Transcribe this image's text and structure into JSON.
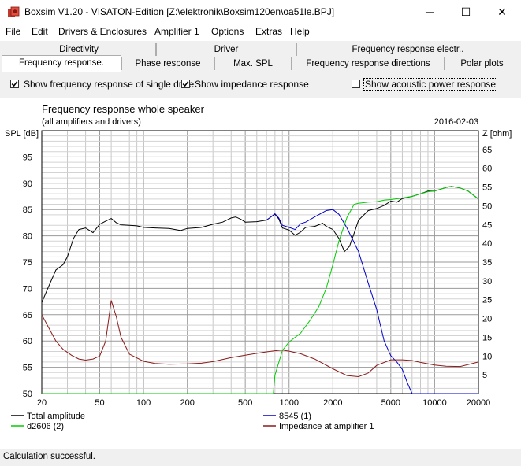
{
  "window": {
    "title": "Boxsim V1.20 - VISATON-Edition [Z:\\elektronik\\Boxsim120en\\oa51le.BPJ]",
    "minimize": "─",
    "maximize": "☐",
    "close": "✕"
  },
  "menu": [
    "File",
    "Edit",
    "Drivers & Enclosures",
    "Amplifier 1",
    "Options",
    "Extras",
    "Help"
  ],
  "tabs": {
    "row1": [
      "Directivity",
      "Driver",
      "Frequency response electr.."
    ],
    "row2": [
      "Frequency response.",
      "Phase response",
      "Max. SPL",
      "Frequency response directions",
      "Polar plots"
    ],
    "active": "Frequency response."
  },
  "options": {
    "single_drive": {
      "label": "Show frequency response of single drive",
      "checked": true
    },
    "impedance": {
      "label": "Show impedance response",
      "checked": true
    },
    "acoustic_power": {
      "label": "Show acoustic power response",
      "checked": false
    }
  },
  "status": "Calculation successful.",
  "chart_data": {
    "type": "line",
    "title": "Frequency response whole speaker",
    "subtitle": "(all amplifiers and drivers)",
    "date": "2016-02-03",
    "ylabel": "SPL [dB]",
    "y2label": "Z [ohm]",
    "x_scale": "log",
    "xlim": [
      20,
      20000
    ],
    "ylim": [
      50,
      100
    ],
    "y2lim": [
      0,
      70
    ],
    "x_ticks": [
      20,
      50,
      100,
      200,
      500,
      1000,
      2000,
      5000,
      10000,
      20000
    ],
    "x_tick_labels": [
      "20",
      "50",
      "100",
      "200",
      "500",
      "1000",
      "2000",
      "5000",
      "10000",
      "20000"
    ],
    "y_ticks": [
      50,
      55,
      60,
      65,
      70,
      75,
      80,
      85,
      90,
      95
    ],
    "y2_ticks": [
      5,
      10,
      15,
      20,
      25,
      30,
      35,
      40,
      45,
      50,
      55,
      60,
      65
    ],
    "grid": true,
    "legend_position": "bottom",
    "series": [
      {
        "name": "Total amplitude",
        "color": "#000000",
        "axis": "left",
        "points": [
          [
            20,
            67.3
          ],
          [
            22,
            70
          ],
          [
            25,
            73.5
          ],
          [
            28,
            74.5
          ],
          [
            30,
            76
          ],
          [
            33,
            79.5
          ],
          [
            36,
            81.2
          ],
          [
            40,
            81.5
          ],
          [
            45,
            80.6
          ],
          [
            50,
            82.2
          ],
          [
            55,
            82.8
          ],
          [
            60,
            83.3
          ],
          [
            65,
            82.5
          ],
          [
            70,
            82.1
          ],
          [
            80,
            82.0
          ],
          [
            90,
            81.9
          ],
          [
            100,
            81.6
          ],
          [
            120,
            81.5
          ],
          [
            150,
            81.4
          ],
          [
            180,
            81.0
          ],
          [
            200,
            81.4
          ],
          [
            250,
            81.6
          ],
          [
            300,
            82.2
          ],
          [
            350,
            82.6
          ],
          [
            400,
            83.4
          ],
          [
            430,
            83.6
          ],
          [
            470,
            83.1
          ],
          [
            500,
            82.6
          ],
          [
            600,
            82.7
          ],
          [
            700,
            83.0
          ],
          [
            750,
            83.6
          ],
          [
            800,
            84.1
          ],
          [
            850,
            83.2
          ],
          [
            900,
            81.5
          ],
          [
            1000,
            81.1
          ],
          [
            1100,
            80.1
          ],
          [
            1200,
            80.7
          ],
          [
            1300,
            81.6
          ],
          [
            1500,
            81.8
          ],
          [
            1700,
            82.4
          ],
          [
            1800,
            81.8
          ],
          [
            2000,
            81.2
          ],
          [
            2200,
            79.5
          ],
          [
            2400,
            77.0
          ],
          [
            2600,
            78.0
          ],
          [
            2800,
            80.5
          ],
          [
            3000,
            83.0
          ],
          [
            3500,
            84.8
          ],
          [
            4000,
            85.2
          ],
          [
            4500,
            85.8
          ],
          [
            5000,
            86.6
          ],
          [
            5500,
            86.4
          ],
          [
            6000,
            87.1
          ],
          [
            7000,
            87.5
          ],
          [
            8000,
            88.0
          ],
          [
            9000,
            88.5
          ],
          [
            10000,
            88.5
          ],
          [
            12000,
            89.2
          ],
          [
            13000,
            89.4
          ],
          [
            15000,
            89.1
          ],
          [
            17000,
            88.5
          ],
          [
            20000,
            87.0
          ]
        ]
      },
      {
        "name": "8545 (1)",
        "color": "#0000cc",
        "axis": "left",
        "points": [
          [
            700,
            83.0
          ],
          [
            750,
            83.6
          ],
          [
            800,
            84.2
          ],
          [
            850,
            83.4
          ],
          [
            900,
            82.0
          ],
          [
            1000,
            81.6
          ],
          [
            1100,
            81.2
          ],
          [
            1200,
            82.3
          ],
          [
            1300,
            82.6
          ],
          [
            1500,
            83.6
          ],
          [
            1800,
            84.8
          ],
          [
            2000,
            85.0
          ],
          [
            2200,
            84.1
          ],
          [
            2500,
            81.5
          ],
          [
            3000,
            77.0
          ],
          [
            3500,
            71.0
          ],
          [
            4000,
            66.0
          ],
          [
            4500,
            60.0
          ],
          [
            5000,
            57.2
          ],
          [
            5500,
            56.0
          ],
          [
            6000,
            54.6
          ],
          [
            6500,
            52.0
          ],
          [
            7000,
            50.0
          ],
          [
            20000,
            50.0
          ]
        ]
      },
      {
        "name": "d2606 (2)",
        "color": "#00cc00",
        "axis": "left",
        "points": [
          [
            20,
            50
          ],
          [
            780,
            50
          ],
          [
            800,
            53.5
          ],
          [
            900,
            58.2
          ],
          [
            1000,
            59.8
          ],
          [
            1200,
            61.5
          ],
          [
            1400,
            64.0
          ],
          [
            1600,
            66.5
          ],
          [
            1800,
            70.0
          ],
          [
            2000,
            74.5
          ],
          [
            2200,
            79.0
          ],
          [
            2500,
            83.5
          ],
          [
            2800,
            86.0
          ],
          [
            3000,
            86.2
          ],
          [
            3500,
            86.4
          ],
          [
            4000,
            86.5
          ],
          [
            4500,
            86.8
          ],
          [
            5000,
            86.9
          ],
          [
            6000,
            87.2
          ],
          [
            7000,
            87.5
          ],
          [
            8000,
            88.0
          ],
          [
            9000,
            88.4
          ],
          [
            10000,
            88.5
          ],
          [
            12000,
            89.2
          ],
          [
            13000,
            89.4
          ],
          [
            15000,
            89.1
          ],
          [
            17000,
            88.5
          ],
          [
            20000,
            87.0
          ]
        ]
      },
      {
        "name": "Impedance at amplifier 1",
        "color": "#8b1a1a",
        "axis": "right",
        "points": [
          [
            20,
            21.0
          ],
          [
            22,
            18.0
          ],
          [
            25,
            14.0
          ],
          [
            28,
            11.8
          ],
          [
            32,
            10.2
          ],
          [
            36,
            9.2
          ],
          [
            40,
            8.9
          ],
          [
            45,
            9.2
          ],
          [
            50,
            10.0
          ],
          [
            55,
            14.0
          ],
          [
            60,
            24.8
          ],
          [
            65,
            20.5
          ],
          [
            70,
            15.0
          ],
          [
            80,
            10.5
          ],
          [
            100,
            8.6
          ],
          [
            120,
            8.0
          ],
          [
            150,
            7.8
          ],
          [
            200,
            7.9
          ],
          [
            250,
            8.1
          ],
          [
            300,
            8.5
          ],
          [
            400,
            9.6
          ],
          [
            500,
            10.2
          ],
          [
            600,
            10.7
          ],
          [
            700,
            11.1
          ],
          [
            800,
            11.4
          ],
          [
            900,
            11.6
          ],
          [
            1000,
            11.3
          ],
          [
            1200,
            10.6
          ],
          [
            1500,
            9.2
          ],
          [
            2000,
            6.6
          ],
          [
            2500,
            4.8
          ],
          [
            3000,
            4.5
          ],
          [
            3500,
            5.5
          ],
          [
            4000,
            7.5
          ],
          [
            5000,
            9.0
          ],
          [
            6000,
            9.0
          ],
          [
            7000,
            8.8
          ],
          [
            8000,
            8.3
          ],
          [
            10000,
            7.6
          ],
          [
            12000,
            7.3
          ],
          [
            15000,
            7.2
          ],
          [
            20000,
            8.4
          ]
        ]
      }
    ]
  }
}
